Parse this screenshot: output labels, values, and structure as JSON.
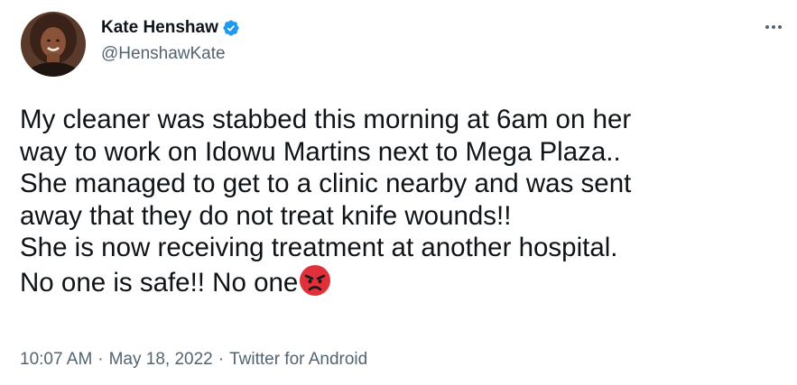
{
  "author": {
    "display_name": "Kate Henshaw",
    "handle": "@HenshawKate",
    "verified": true,
    "verified_color": "#1d9bf0",
    "avatar_icon": "profile-photo"
  },
  "more_icon": "more-horizontal-icon",
  "tweet": {
    "lines": [
      "My cleaner was stabbed this morning at 6am on her",
      "way to work on Idowu Martins next to Mega Plaza..",
      "She managed to get to a clinic nearby and was sent",
      "away that they do not treat knife wounds!!",
      "She is now receiving treatment at another hospital.",
      "No one is safe!! No one"
    ],
    "emoji": "angry-face-emoji"
  },
  "meta": {
    "time": "10:07 AM",
    "date": "May 18, 2022",
    "source": "Twitter for Android",
    "separator": "·"
  },
  "colors": {
    "text": "#0f1419",
    "secondary": "#536471",
    "emoji_red": "#e0303a"
  }
}
